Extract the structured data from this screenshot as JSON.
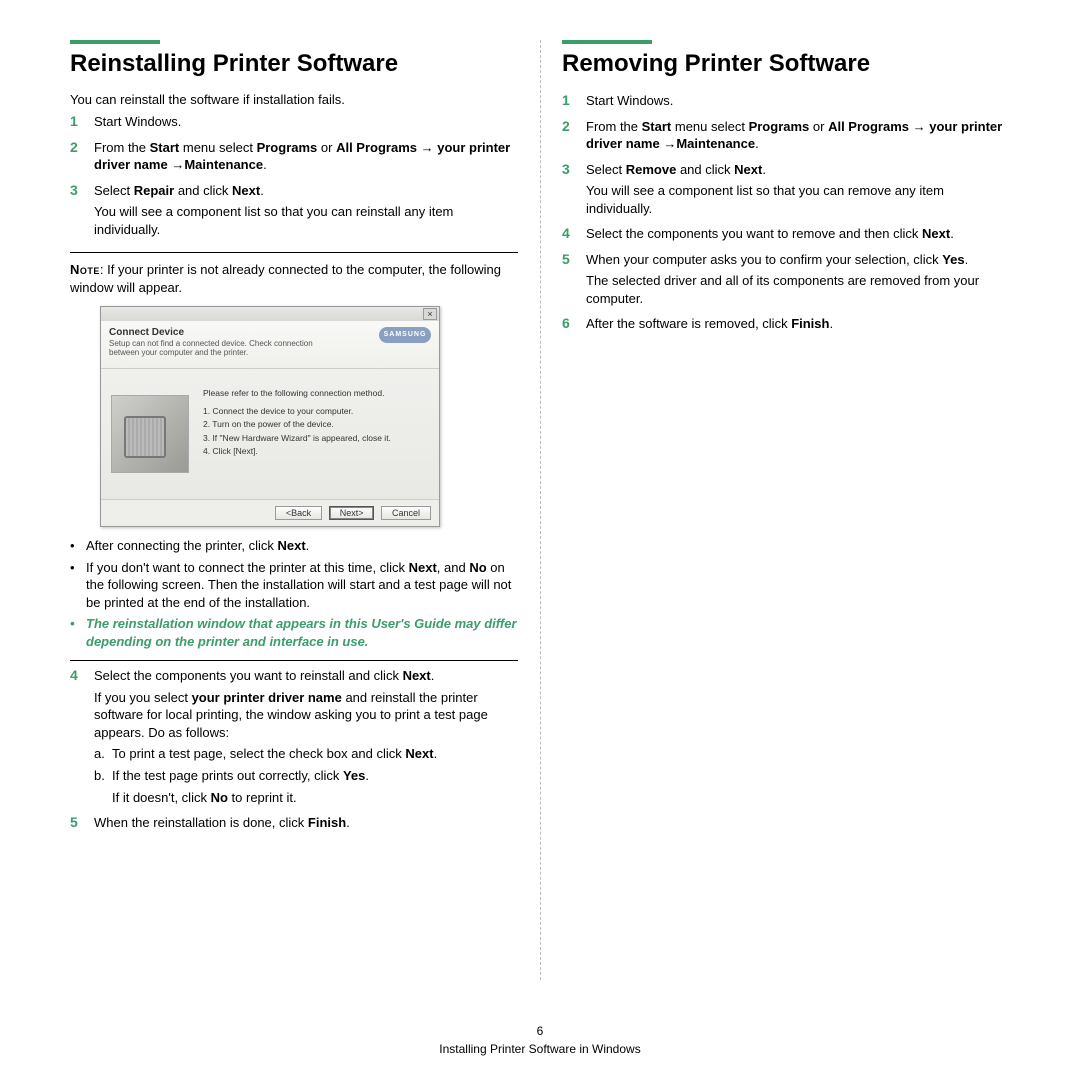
{
  "left": {
    "title": "Reinstalling Printer Software",
    "intro": "You can reinstall the software if installation fails.",
    "steps": {
      "s1": "Start Windows.",
      "s2_a": "From the ",
      "s2_b": "Start",
      "s2_c": " menu select ",
      "s2_d": "Programs",
      "s2_e": " or ",
      "s2_f": "All Programs",
      "s2_g": " → ",
      "s2_h": "your printer driver name",
      "s2_i": " →",
      "s2_j": "Maintenance",
      "s2_k": ".",
      "s3_a": "Select ",
      "s3_b": "Repair",
      "s3_c": " and click ",
      "s3_d": "Next",
      "s3_e": ".",
      "s3_sub": "You will see a component list so that you can reinstall any item individually.",
      "note_label": "Note",
      "note_text": ": If your printer is not already connected to the computer, the following window will appear.",
      "bullet1_a": "After connecting the printer, click ",
      "bullet1_b": "Next",
      "bullet1_c": ".",
      "bullet2_a": "If you don't want to connect the printer at this time, click ",
      "bullet2_b": "Next",
      "bullet2_c": ", and ",
      "bullet2_d": "No",
      "bullet2_e": " on the following screen. Then the installation will start and a test page will not be printed at the end of the installation.",
      "bullet3": "The reinstallation window that appears in this User's Guide may differ depending on the printer and interface in use.",
      "s4_a": "Select the components you want to reinstall and click ",
      "s4_b": "Next",
      "s4_c": ".",
      "s4_p2_a": "If you you select ",
      "s4_p2_b": "your printer driver name",
      "s4_p2_c": " and reinstall the printer software for local printing, the window asking you to print a test page appears. Do as follows:",
      "s4_a1_a": "To print a test page, select the check box and click ",
      "s4_a1_b": "Next",
      "s4_a1_c": ".",
      "s4_b1_a": "If the test page prints out correctly, click ",
      "s4_b1_b": "Yes",
      "s4_b1_c": ".",
      "s4_b2_a": "If it doesn't, click ",
      "s4_b2_b": "No",
      "s4_b2_c": " to reprint it.",
      "s5_a": "When the reinstallation is done, click ",
      "s5_b": "Finish",
      "s5_c": "."
    }
  },
  "screenshot": {
    "close": "×",
    "title": "Connect Device",
    "subtitle": "Setup can not find a connected device. Check connection between your computer and the printer.",
    "logo": "SAMSUNG",
    "lead": "Please refer to the following connection method.",
    "i1": "1. Connect the device to your computer.",
    "i2": "2. Turn on the power of the device.",
    "i3": "3. If \"New Hardware Wizard\" is appeared, close it.",
    "i4": "4. Click [Next].",
    "back": "<Back",
    "next": "Next>",
    "cancel": "Cancel"
  },
  "right": {
    "title": "Removing Printer Software",
    "s1": "Start Windows.",
    "s2_a": "From the ",
    "s2_b": "Start",
    "s2_c": " menu select ",
    "s2_d": "Programs",
    "s2_e": " or ",
    "s2_f": "All Programs",
    "s2_g": " → ",
    "s2_h": "your printer driver name",
    "s2_i": " →",
    "s2_j": "Maintenance",
    "s2_k": ".",
    "s3_a": "Select ",
    "s3_b": "Remove",
    "s3_c": " and click ",
    "s3_d": "Next",
    "s3_e": ".",
    "s3_sub": "You will see a component list so that you can remove any item individually.",
    "s4_a": "Select the components you want to remove and then click ",
    "s4_b": "Next",
    "s4_c": ".",
    "s5_a": "When your computer asks you to confirm your selection, click ",
    "s5_b": "Yes",
    "s5_c": ".",
    "s5_sub": "The selected driver and all of its components are removed from your computer.",
    "s6_a": "After the software is removed, click ",
    "s6_b": "Finish",
    "s6_c": "."
  },
  "footer": {
    "page": "6",
    "section": "Installing Printer Software in Windows"
  }
}
